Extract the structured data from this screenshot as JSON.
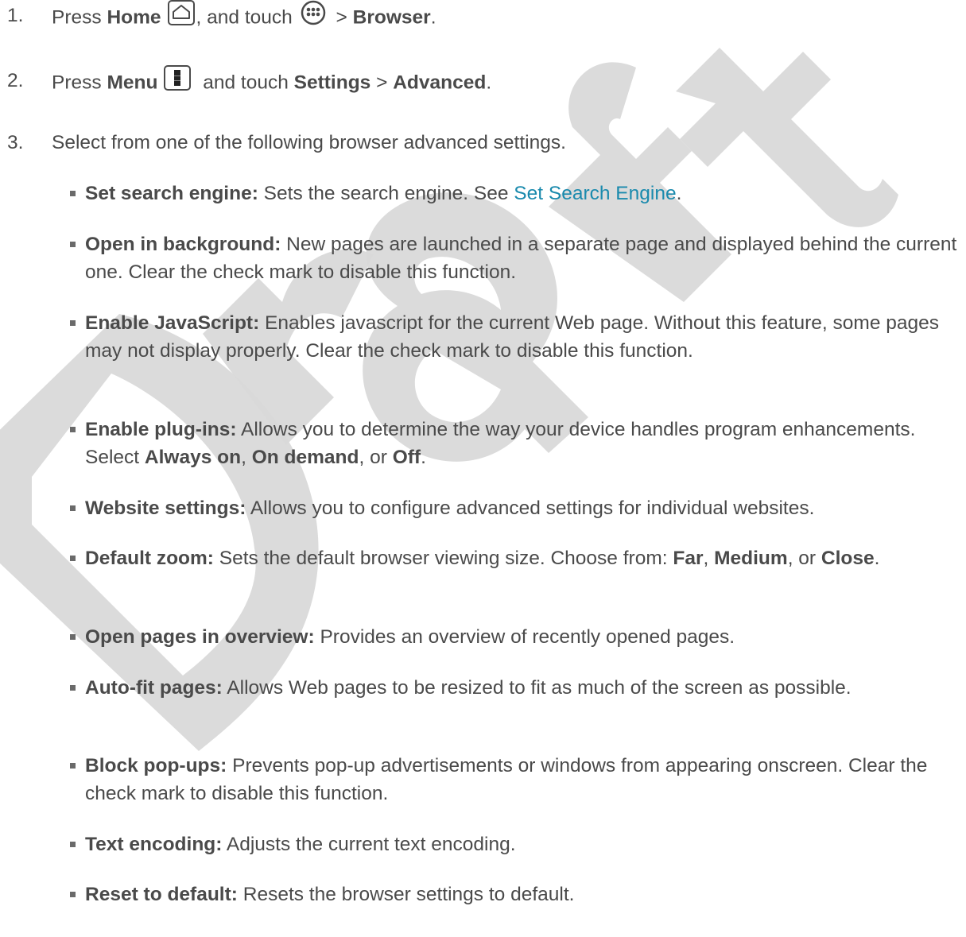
{
  "watermark": "Draft",
  "steps": [
    {
      "num": "1.",
      "press": "Press ",
      "key1": "Home",
      "mid": ", and touch",
      "sep": " > ",
      "target": "Browser",
      "end": "."
    },
    {
      "num": "2.",
      "press": "Press ",
      "key1": "Menu",
      "mid": " and touch ",
      "target": "Settings",
      "sep": " > ",
      "target2": "Advanced",
      "end": "."
    },
    {
      "num": "3.",
      "text": "Select from one of the following browser advanced settings."
    }
  ],
  "icons": {
    "home": "home-key-icon",
    "apps": "all-apps-icon",
    "menu": "menu-key-icon"
  },
  "settings": [
    {
      "term": "Set search engine:",
      "desc": " Sets the search engine. See ",
      "link": "Set Search Engine",
      "end": "."
    },
    {
      "term": "Open in background:",
      "desc": " New pages are launched in a separate page and displayed behind the current one. Clear the check mark to disable this function."
    },
    {
      "term": "Enable JavaScript:",
      "desc": " Enables javascript for the current Web page. Without this feature, some pages may not display properly. Clear the check mark to disable this function."
    },
    {
      "term": "Enable plug-ins:",
      "desc": " Allows you to determine the way your device handles program enhancements. Select ",
      "opt1": "Always on",
      "sep1": ", ",
      "opt2": "On demand",
      "sep2": ", or ",
      "opt3": "Off",
      "end": "."
    },
    {
      "term": "Website settings:",
      "desc": " Allows you to configure advanced settings for individual websites."
    },
    {
      "term": "Default zoom:",
      "desc": " Sets the default browser viewing size. Choose from: ",
      "opt1": "Far",
      "sep1": ", ",
      "opt2": "Medium",
      "sep2": ", or ",
      "opt3": "Close",
      "end": "."
    },
    {
      "term": "Open pages in overview:",
      "desc": " Provides an overview of recently opened pages."
    },
    {
      "term": "Auto-fit pages:",
      "desc": " Allows Web pages to be resized to fit as much of the screen as possible."
    },
    {
      "term": "Block pop-ups:",
      "desc": " Prevents pop-up advertisements or windows from appearing onscreen. Clear the check mark to disable this function."
    },
    {
      "term": "Text encoding:",
      "desc": " Adjusts the current text encoding."
    },
    {
      "term": "Reset to default:",
      "desc": " Resets the browser settings to default."
    }
  ],
  "colors": {
    "text": "#4a4a4a",
    "link": "#1a8aad",
    "watermark": "#d9d9d9"
  }
}
